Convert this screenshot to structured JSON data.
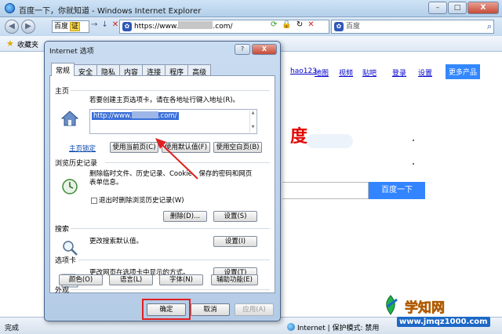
{
  "window": {
    "title": "百度一下，你就知道 - Windows Internet Explorer",
    "minimize": "–",
    "maximize": "□",
    "close": "X"
  },
  "nav": {
    "back": "◀",
    "forward": "▶",
    "engine_label": "百度",
    "engine_tag": "证",
    "address_prefix": "https://www.",
    "address_suffix": ".com/",
    "search_placeholder": "百度"
  },
  "favorites": {
    "label": "收藏夹"
  },
  "page": {
    "nav_links": [
      "hao123",
      "地图",
      "视频",
      "贴吧",
      "登录",
      "设置"
    ],
    "more_products": "更多产品",
    "logo_fragment": "度",
    "search_button": "百度一下"
  },
  "status": {
    "left": "完成",
    "zone": "Internet | 保护模式: 禁用"
  },
  "watermark": {
    "title": "学知网",
    "url": "www.jmqz1000.com"
  },
  "dialog": {
    "title": "Internet 选项",
    "help": "?",
    "close": "X",
    "tabs": [
      "常规",
      "安全",
      "隐私",
      "内容",
      "连接",
      "程序",
      "高级"
    ],
    "active_tab": "常规",
    "homepage": {
      "heading": "主页",
      "instruction": "若要创建主页选项卡，请在各地址行键入地址(R)。",
      "url_prefix": "http://www.",
      "url_suffix": ".com/",
      "link": "主页锁定",
      "btn_current": "使用当前页(C)",
      "btn_default": "使用默认值(F)",
      "btn_blank": "使用空白页(B)"
    },
    "history": {
      "heading": "浏览历史记录",
      "desc": "删除临时文件、历史记录、Cookie、保存的密码和网页表单信息。",
      "checkbox": "退出时删除浏览历史记录(W)",
      "btn_delete": "删除(D)...",
      "btn_settings": "设置(S)"
    },
    "search": {
      "heading": "搜索",
      "desc": "更改搜索默认值。",
      "btn_settings": "设置(I)"
    },
    "tabsect": {
      "heading": "选项卡",
      "desc": "更改网页在选项卡中显示的方式。",
      "btn_settings": "设置(T)"
    },
    "appearance": {
      "heading": "外观",
      "btn_colors": "颜色(O)",
      "btn_languages": "语言(L)",
      "btn_fonts": "字体(N)",
      "btn_accessibility": "辅助功能(E)"
    },
    "footer": {
      "ok": "确定",
      "cancel": "取消",
      "apply": "应用(A)"
    }
  },
  "colors": {
    "annotation_red": "#e02020",
    "baidu_blue": "#3385ff",
    "selection_blue": "#3a6fd8"
  }
}
